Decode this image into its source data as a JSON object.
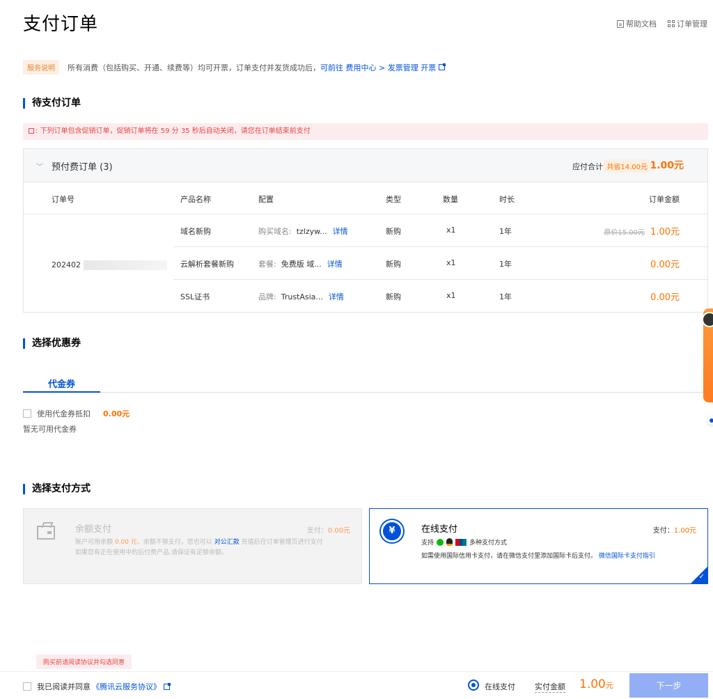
{
  "header": {
    "title": "支付订单",
    "help_doc": "帮助文档",
    "order_manage": "订单管理"
  },
  "service_note": {
    "badge": "服务说明",
    "text": "所有消费（包括购买、开通、续费等）均可开票，订单支付并发货成功后，",
    "link_prefix": "可前往",
    "link_path": "费用中心 > 发票管理",
    "link_action": "开票"
  },
  "pending": {
    "title": "待支付订单",
    "promo_notice": "下列订单包含促销订单，促销订单将在 59 分 35 秒后自动关闭，请您在订单结束前支付",
    "group_title": "预付费订单 (3)",
    "due_label": "应付合计",
    "saved_badge": "共省14.00元",
    "total": "1.00元",
    "columns": [
      "订单号",
      "产品名称",
      "配置",
      "类型",
      "数量",
      "时长",
      "订单金额"
    ],
    "order_no_prefix": "202402",
    "rows": [
      {
        "product": "域名新购",
        "conf_label": "购买域名:",
        "conf_value": "tzlzyw...",
        "detail": "详情",
        "type": "新购",
        "qty": "x1",
        "duration": "1年",
        "orig_price": "原价15.00元",
        "amount": "1.00元"
      },
      {
        "product": "云解析套餐新购",
        "conf_label": "套餐:",
        "conf_value": "免费版 域...",
        "detail": "详情",
        "type": "新购",
        "qty": "x1",
        "duration": "1年",
        "orig_price": "",
        "amount": "0.00元"
      },
      {
        "product": "SSL证书",
        "conf_label": "品牌:",
        "conf_value": "TrustAsia...",
        "detail": "详情",
        "type": "新购",
        "qty": "x1",
        "duration": "1年",
        "orig_price": "",
        "amount": "0.00元"
      }
    ]
  },
  "voucher": {
    "title": "选择优惠券",
    "tab": "代金券",
    "use_label": "使用代金券抵扣",
    "use_amount": "0.00元",
    "empty": "暂无可用代金券"
  },
  "payment": {
    "title": "选择支付方式",
    "balance": {
      "name": "余额支付",
      "pay_label": "支付：",
      "pay_amount": "0.00元",
      "desc_1": "账户可用余额",
      "desc_amount": "0.00 元",
      "desc_2": "，余额不够支付，您也可以",
      "desc_link": "对公汇款",
      "desc_3": "充值后在订单管理页进行支付",
      "desc_line2": "如果您有正在使用中的后付费产品,请保证有足够余额。"
    },
    "online": {
      "name": "在线支付",
      "pay_label": "支付：",
      "pay_amount": "1.00元",
      "support_prefix": "支持",
      "support_suffix": "多种支付方式",
      "note": "如需使用国际信用卡支付，请在微信支付里添加国际卡后支付。",
      "note_link": "微信国际卡支付指引"
    }
  },
  "footer": {
    "warning": "购买前请阅读协议并勾选同意",
    "agree_prefix": "我已阅读并同意",
    "agree_link": "《腾讯云服务协议》",
    "pay_method": "在线支付",
    "actual_label": "实付金额",
    "actual_amount": "1.00",
    "actual_unit": "元",
    "next": "下一步"
  },
  "colors": {
    "accent": "#0052d9",
    "price": "#ff7200",
    "warning": "#e54545"
  }
}
